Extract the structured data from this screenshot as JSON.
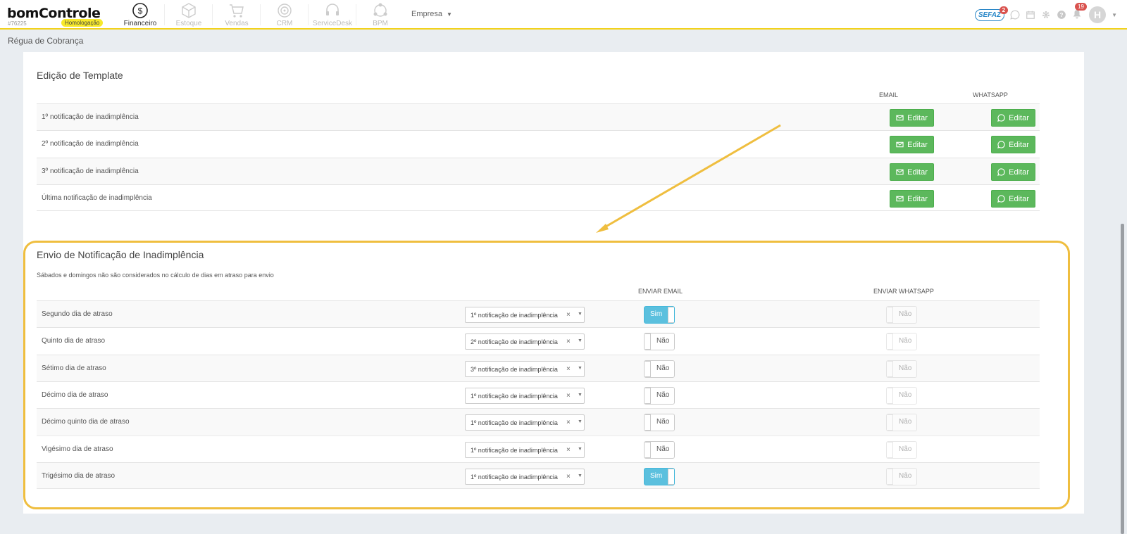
{
  "header": {
    "logo": "bomControle",
    "company_id": "#76225",
    "environment_badge": "Homologação",
    "modules": [
      {
        "label": "Financeiro",
        "icon": "dollar-circle-icon",
        "active": true
      },
      {
        "label": "Estoque",
        "icon": "box-icon",
        "active": false
      },
      {
        "label": "Vendas",
        "icon": "cart-icon",
        "active": false
      },
      {
        "label": "CRM",
        "icon": "target-icon",
        "active": false
      },
      {
        "label": "ServiceDesk",
        "icon": "headset-icon",
        "active": false
      },
      {
        "label": "BPM",
        "icon": "workflow-icon",
        "active": false
      }
    ],
    "company_menu": "Empresa",
    "sefaz_label": "SEFAZ",
    "sefaz_count": "2",
    "notifications_count": "19",
    "avatar_initial": "H"
  },
  "breadcrumb": "Régua de Cobrança",
  "templates": {
    "title": "Edição de Template",
    "col_email": "EMAIL",
    "col_whatsapp": "WHATSAPP",
    "edit_label": "Editar",
    "rows": [
      "1º notificação de inadimplência",
      "2º notificação de inadimplência",
      "3º notificação de inadimplência",
      "Última notificação de inadimplência"
    ]
  },
  "sending": {
    "title": "Envio de Notificação de Inadimplência",
    "note": "Sábados e domingos não são considerados no cálculo de dias em atraso para envio",
    "col_email": "ENVIAR EMAIL",
    "col_whatsapp": "ENVIAR WHATSAPP",
    "clear_symbol": "×",
    "rows": [
      {
        "day": "Segundo dia de atraso",
        "template": "1º notificação de inadimplência",
        "email": "Sim",
        "whatsapp": "Não"
      },
      {
        "day": "Quinto dia de atraso",
        "template": "2º notificação de inadimplência",
        "email": "Não",
        "whatsapp": "Não"
      },
      {
        "day": "Sétimo dia de atraso",
        "template": "3º notificação de inadimplência",
        "email": "Não",
        "whatsapp": "Não"
      },
      {
        "day": "Décimo dia de atraso",
        "template": "1º notificação de inadimplência",
        "email": "Não",
        "whatsapp": "Não"
      },
      {
        "day": "Décimo quinto dia de atraso",
        "template": "1º notificação de inadimplência",
        "email": "Não",
        "whatsapp": "Não"
      },
      {
        "day": "Vigésimo dia de atraso",
        "template": "1º notificação de inadimplência",
        "email": "Não",
        "whatsapp": "Não"
      },
      {
        "day": "Trigésimo dia de atraso",
        "template": "1º notificação de inadimplência",
        "email": "Sim",
        "whatsapp": "Não"
      }
    ]
  },
  "colors": {
    "accent_yellow": "#f2d21c",
    "button_green": "#5cb85c",
    "toggle_on": "#5bc0de",
    "highlight": "#efbe3f"
  }
}
